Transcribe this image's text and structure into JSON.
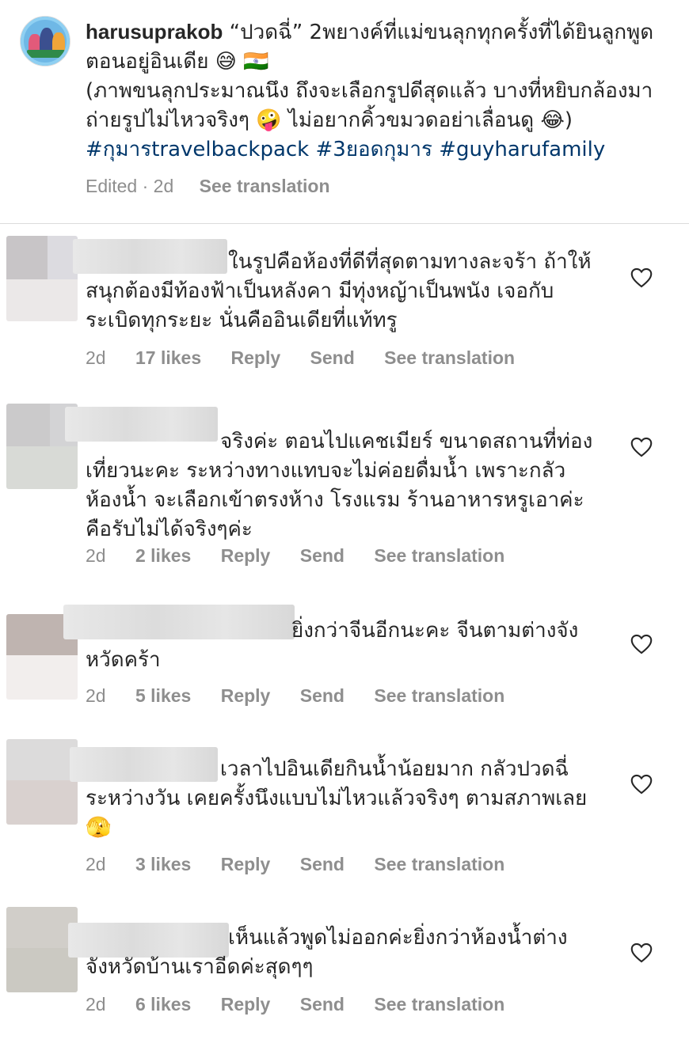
{
  "post": {
    "username": "harusuprakob",
    "caption_line1": " “ปวดฉี่” 2พยางค์ที่แม่ขนลุกทุกครั้งที่ได้ยินลูกพูดตอนอยู่อินเดีย 😅 🇮🇳",
    "caption_line2": "(ภาพขนลุกประมาณนึง ถึงจะเลือกรูปดีสุดแล้ว บางที่หยิบกล้องมาถ่ายรูปไม่ไหวจริงๆ 🤪 ไม่อยากคิ้วขมวดอย่าเลื่อนดู 😂)",
    "hashtags": "#กุมารtravelbackpack #3ยอดกุมาร #guyharufamily",
    "meta_edited": "Edited · 2d",
    "meta_see_translation": "See translation"
  },
  "comments": [
    {
      "text": "ในรูปคือห้องที่ดีที่สุดตามทางละจร้า ถ้าให้สนุกต้องมีท้องฟ้าเป็นหลังคา มีทุ่งหญ้าเป็นพนัง เจอกับระเบิดทุกระยะ นั่นคืออินเดียที่แท้ทรู",
      "time": "2d",
      "likes": "17 likes",
      "reply": "Reply",
      "send": "Send",
      "see_translation": "See translation"
    },
    {
      "text": "จริงค่ะ ตอนไปแคชเมียร์ ขนาดสถานที่ท่องเที่ยวนะคะ ระหว่างทางแทบจะไม่ค่อยดื่มน้ำ เพราะกลัวห้องน้ำ จะเลือกเข้าตรงห้าง โรงแรม ร้านอาหารหรูเอาค่ะ คือรับไม่ได้จริงๆค่ะ",
      "time": "2d",
      "likes": "2 likes",
      "reply": "Reply",
      "send": "Send",
      "see_translation": "See translation"
    },
    {
      "text": "ยิ่งกว่าจีนอีกนะคะ จีนตามต่างจังหวัดคร้า",
      "time": "2d",
      "likes": "5 likes",
      "reply": "Reply",
      "send": "Send",
      "see_translation": "See translation"
    },
    {
      "text": "เวลาไปอินเดียกินน้ำน้อยมาก กลัวปวดฉี่ระหว่างวัน เคยครั้งนึงแบบไม่ไหวแล้วจริงๆ ตามสภาพเลย 🫣",
      "time": "2d",
      "likes": "3 likes",
      "reply": "Reply",
      "send": "Send",
      "see_translation": "See translation"
    },
    {
      "text": "เห็นแล้วพูดไม่ออกค่ะยิ่งกว่าห้องน้ำต่างจังหวัดบ้านเราอีดค่ะสุดๆๆ",
      "time": "2d",
      "likes": "6 likes",
      "reply": "Reply",
      "send": "Send",
      "see_translation": "See translation"
    }
  ],
  "colors": {
    "text": "#262626",
    "meta": "#8e8e8e",
    "hashtag": "#00376b",
    "divider": "#dbdbdb"
  },
  "icons": {
    "like": "heart-outline-icon"
  }
}
